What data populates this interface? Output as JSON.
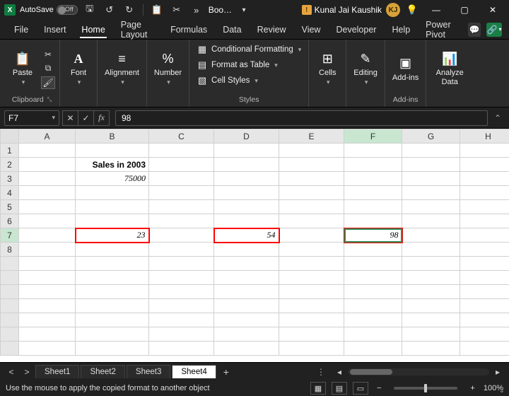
{
  "titlebar": {
    "autosave_label": "AutoSave",
    "doc_title": "Boo…",
    "user_name": "Kunal Jai Kaushik",
    "user_initials": "KJ"
  },
  "menu": {
    "tabs": [
      "File",
      "Insert",
      "Home",
      "Page Layout",
      "Formulas",
      "Data",
      "Review",
      "View",
      "Developer",
      "Help",
      "Power Pivot"
    ],
    "active": "Home"
  },
  "ribbon": {
    "clipboard": {
      "paste": "Paste",
      "label": "Clipboard"
    },
    "font": {
      "label": "Font",
      "btn": "Font"
    },
    "alignment": {
      "label": "Alignment",
      "btn": "Alignment"
    },
    "number": {
      "label": "Number",
      "btn": "Number"
    },
    "styles": {
      "label": "Styles",
      "cond_fmt": "Conditional Formatting",
      "as_table": "Format as Table",
      "cell_styles": "Cell Styles"
    },
    "cells": {
      "btn": "Cells"
    },
    "editing": {
      "btn": "Editing"
    },
    "addins": {
      "btn": "Add-ins",
      "label": "Add-ins"
    },
    "data": {
      "btn": "Analyze Data"
    }
  },
  "formula_bar": {
    "name_box": "F7",
    "value": "98"
  },
  "grid": {
    "columns": [
      "A",
      "B",
      "C",
      "D",
      "E",
      "F",
      "G",
      "H"
    ],
    "rows": [
      "1",
      "2",
      "3",
      "4",
      "5",
      "6",
      "7",
      "8"
    ],
    "active_col": "F",
    "active_row": "7",
    "b2": "Sales in 2003",
    "b3": "75000",
    "b7": "23",
    "d7": "54",
    "f7": "98"
  },
  "chart_data": {
    "type": "table",
    "title": "Sales in 2003",
    "cells": [
      {
        "address": "B2",
        "value": "Sales in 2003"
      },
      {
        "address": "B3",
        "value": 75000
      },
      {
        "address": "B7",
        "value": 23
      },
      {
        "address": "D7",
        "value": 54
      },
      {
        "address": "F7",
        "value": 98
      }
    ]
  },
  "sheets": {
    "tabs": [
      "Sheet1",
      "Sheet2",
      "Sheet3",
      "Sheet4"
    ],
    "active": "Sheet4"
  },
  "statusbar": {
    "msg": "Use the mouse to apply the copied format to another object",
    "zoom": "100%"
  }
}
